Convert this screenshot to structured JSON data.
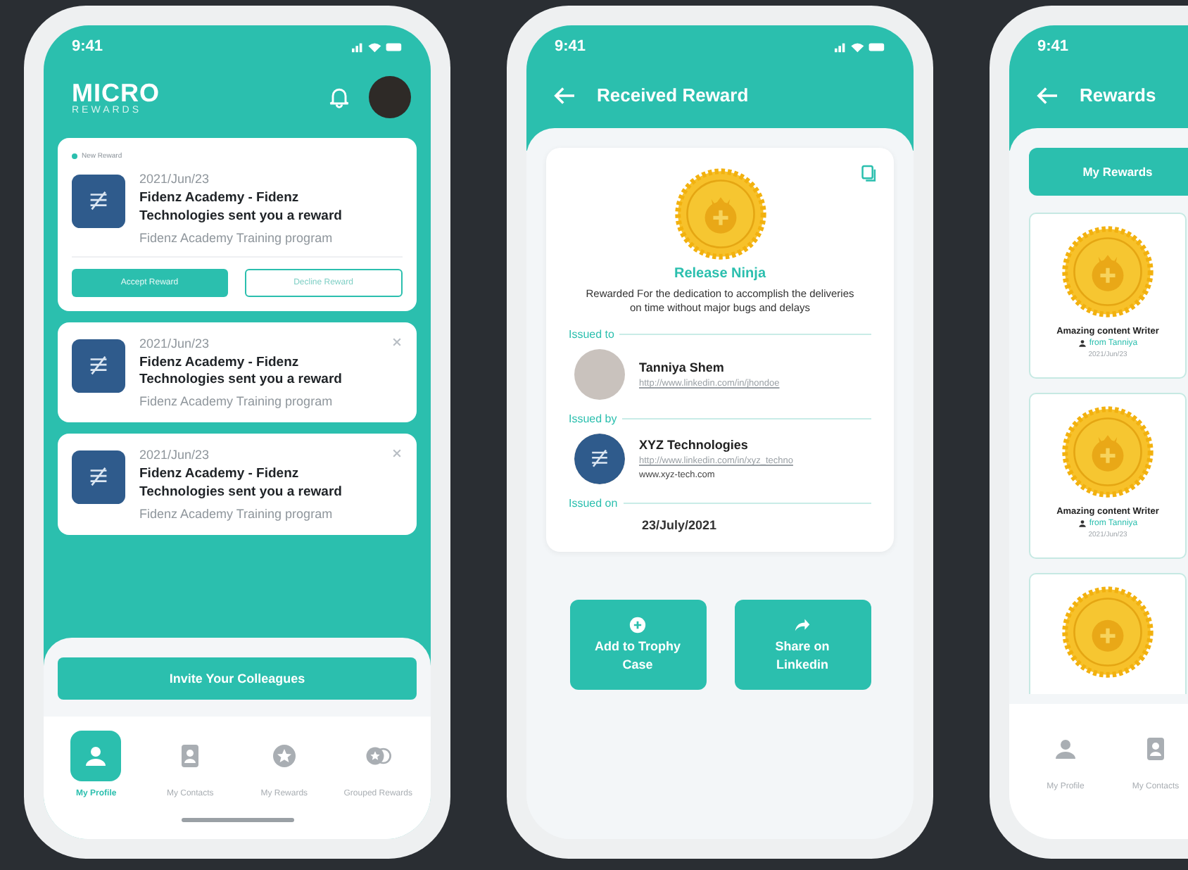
{
  "home_screen": {
    "status_time": "9:41",
    "logo_title": "MICRO",
    "logo_subtitle": "REWARDS",
    "notifications": [
      {
        "badge": "New Reward",
        "date": "2021/Jun/23",
        "title": "Fidenz Academy - Fidenz Technologies sent you a reward",
        "subtitle": "Fidenz Academy Training program",
        "dismissible": false,
        "actions": [
          "Accept Reward",
          "Decline Reward"
        ]
      },
      {
        "date": "2021/Jun/23",
        "title": "Fidenz Academy - Fidenz Technologies sent you a reward",
        "subtitle": "Fidenz Academy Training program",
        "dismissible": true
      },
      {
        "date": "2021/Jun/23",
        "title": "Fidenz Academy - Fidenz Technologies sent you a reward",
        "subtitle": "Fidenz Academy Training program",
        "dismissible": true
      }
    ],
    "invite_button": "Invite Your Colleagues",
    "nav": [
      {
        "label": "My Profile",
        "selected": true
      },
      {
        "label": "My Contacts",
        "selected": false
      },
      {
        "label": "My Rewards",
        "selected": false
      },
      {
        "label": "Grouped Rewards",
        "selected": false
      }
    ]
  },
  "reward_screen": {
    "status_time": "9:41",
    "title": "Received Reward",
    "reward_name": "Release Ninja",
    "description": "Rewarded For the dedication to accomplish the deliveries on time without major bugs and delays",
    "issued_to": {
      "label": "Issued to",
      "name": "Tanniya Shem",
      "link": "http://www.linkedin.com/in/jhondoe"
    },
    "issued_by": {
      "label": "Issued by",
      "name": "XYZ Technologies",
      "link": "http://www.linkedin.com/in/xyz_techno",
      "website": "www.xyz-tech.com"
    },
    "issued_on": {
      "label": "Issued on",
      "date": "23/July/2021"
    },
    "buttons": [
      "Add to Trophy Case",
      "Share on Linkedin"
    ]
  },
  "rewards_screen": {
    "status_time": "9:41",
    "title": "Rewards",
    "tab": "My Rewards",
    "rewards": [
      {
        "title": "Amazing content Writer",
        "from": "from Tanniya",
        "date": "2021/Jun/23"
      },
      {
        "title": "Amazing content Writer",
        "from": "from Tanniya",
        "date": "2021/Jun/23"
      }
    ],
    "nav": [
      {
        "label": "My Profile",
        "selected": false
      },
      {
        "label": "My Contacts",
        "selected": false
      }
    ]
  }
}
